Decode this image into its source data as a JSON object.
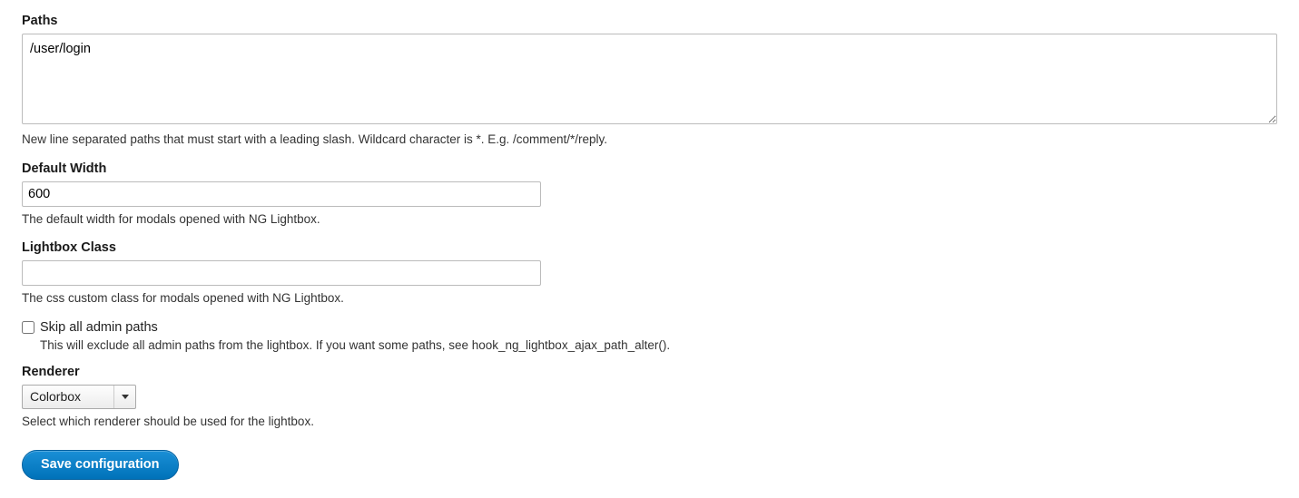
{
  "paths": {
    "label": "Paths",
    "value": "/user/login",
    "description": "New line separated paths that must start with a leading slash. Wildcard character is *. E.g. /comment/*/reply."
  },
  "default_width": {
    "label": "Default Width",
    "value": "600",
    "description": "The default width for modals opened with NG Lightbox."
  },
  "lightbox_class": {
    "label": "Lightbox Class",
    "value": "",
    "description": "The css custom class for modals opened with NG Lightbox."
  },
  "skip_admin": {
    "label": "Skip all admin paths",
    "checked": false,
    "description": "This will exclude all admin paths from the lightbox. If you want some paths, see hook_ng_lightbox_ajax_path_alter()."
  },
  "renderer": {
    "label": "Renderer",
    "selected": "Colorbox",
    "description": "Select which renderer should be used for the lightbox."
  },
  "submit": {
    "label": "Save configuration"
  }
}
